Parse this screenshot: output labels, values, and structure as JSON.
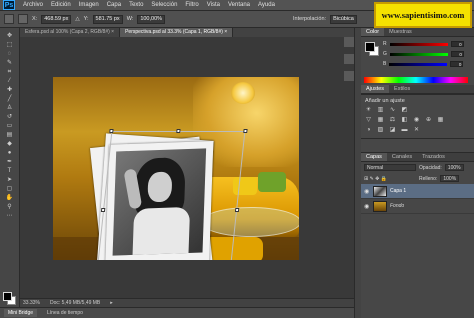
{
  "app": {
    "logo": "Ps"
  },
  "menu": [
    "Archivo",
    "Edición",
    "Imagen",
    "Capa",
    "Texto",
    "Selección",
    "Filtro",
    "Vista",
    "Ventana",
    "Ayuda"
  ],
  "options": {
    "x_label": "X:",
    "x_value": "468.59 px",
    "y_label": "Y:",
    "y_value": "581.75 px",
    "w_label": "W:",
    "w_value": "100,00%",
    "interp_label": "Interpolación:",
    "interp_value": "Bicúbica"
  },
  "watermark": "www.sapientisimo.com",
  "tabs": [
    {
      "label": "Esfera.psd al 100% (Capa 2, RGB/8#) ×",
      "active": false
    },
    {
      "label": "Perspectiva.psd al 33.3% (Capa 1, RGB/8#) ×",
      "active": true
    }
  ],
  "status": {
    "zoom": "33.33%",
    "doc": "Doc: 5,49 MB/5,49 MB"
  },
  "bottom_tabs": [
    {
      "label": "Mini Bridge",
      "active": true
    },
    {
      "label": "Línea de tiempo",
      "active": false
    }
  ],
  "color_panel": {
    "tabs": [
      {
        "label": "Color",
        "active": true
      },
      {
        "label": "Muestras",
        "active": false
      }
    ],
    "rgb": [
      {
        "label": "R",
        "value": "0"
      },
      {
        "label": "G",
        "value": "0"
      },
      {
        "label": "B",
        "value": "0"
      }
    ]
  },
  "adjust_panel": {
    "tabs": [
      {
        "label": "Ajustes",
        "active": true
      },
      {
        "label": "Estilos",
        "active": false
      }
    ],
    "title": "Añadir un ajuste"
  },
  "layers_panel": {
    "tabs": [
      {
        "label": "Capas",
        "active": true
      },
      {
        "label": "Canales",
        "active": false
      },
      {
        "label": "Trazados",
        "active": false
      }
    ],
    "blend_mode": "Normal",
    "opacity_label": "Opacidad:",
    "opacity_value": "100%",
    "fill_label": "Relleno:",
    "fill_value": "100%",
    "layers": [
      {
        "name": "Capa 1",
        "active": true
      },
      {
        "name": "Fondo",
        "active": false
      }
    ]
  }
}
